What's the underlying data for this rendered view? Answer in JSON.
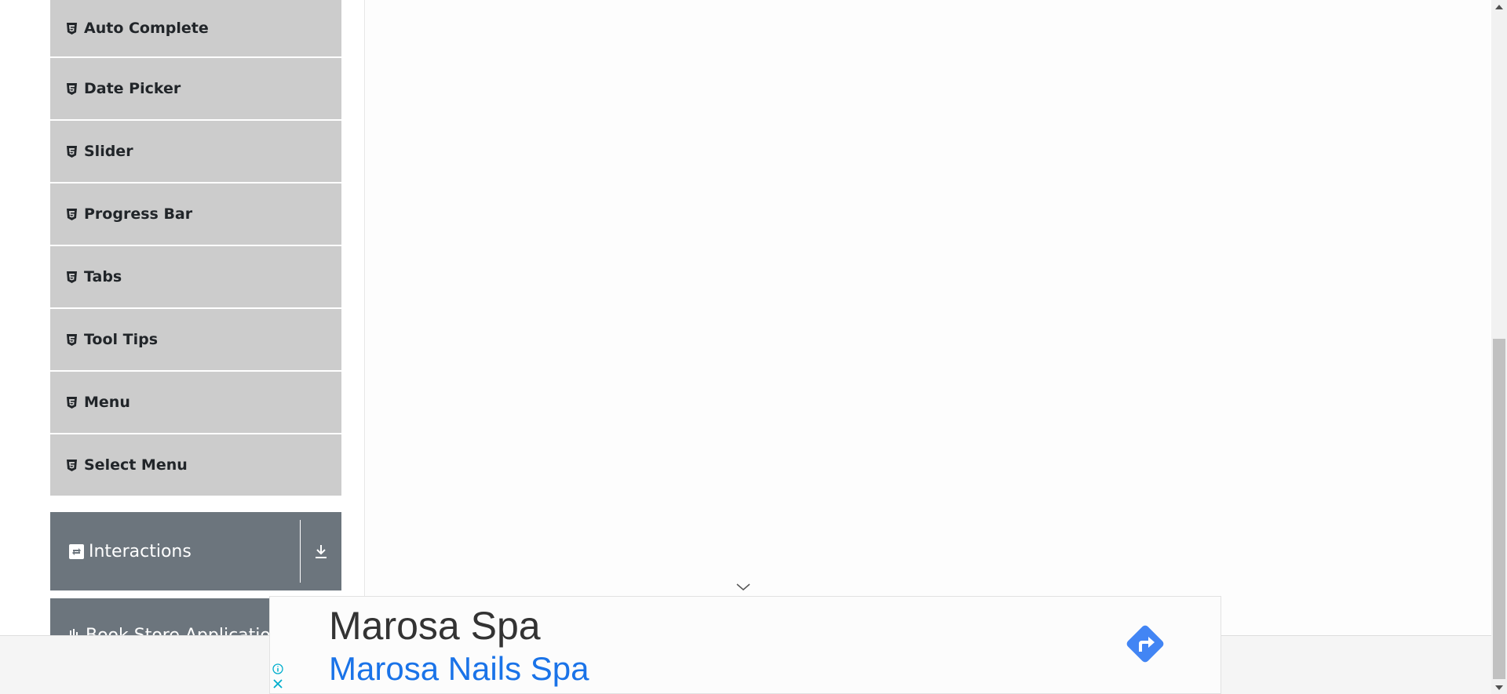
{
  "sidebar": {
    "items": [
      {
        "label": "Auto Complete",
        "icon": "html5-icon"
      },
      {
        "label": "Date Picker",
        "icon": "html5-icon"
      },
      {
        "label": "Slider",
        "icon": "html5-icon"
      },
      {
        "label": "Progress Bar",
        "icon": "html5-icon"
      },
      {
        "label": "Tabs",
        "icon": "html5-icon"
      },
      {
        "label": "Tool Tips",
        "icon": "html5-icon"
      },
      {
        "label": "Menu",
        "icon": "html5-icon"
      },
      {
        "label": "Select Menu",
        "icon": "html5-icon"
      }
    ],
    "groups": [
      {
        "label": "Interactions",
        "icon": "interactions-icon"
      },
      {
        "label": "Book Store Application",
        "icon": "book-store-icon"
      }
    ]
  },
  "ad": {
    "title": "Marosa Spa",
    "subtitle": "Marosa Nails Spa"
  },
  "colors": {
    "menu_item_bg": "#cccccc",
    "group_header_bg": "#6c757d",
    "ad_link": "#1a73e8",
    "direction_icon": "#4285f4",
    "ad_info_icon": "#00aecd"
  }
}
